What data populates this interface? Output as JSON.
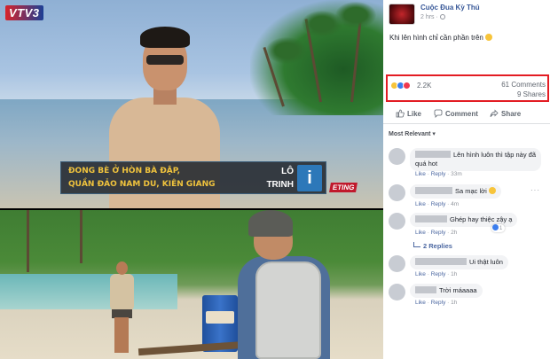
{
  "video": {
    "channel_logo": "VTV3",
    "caption_line1": "ĐONG BÈ Ở HÒN BÀ ĐẬP,",
    "caption_line2": "QUẦN ĐẢO NAM DU, KIÊN GIANG",
    "name_line1": "LÔ",
    "name_line2": "TRINH",
    "badge": "i",
    "corner_logo": "ETING"
  },
  "post": {
    "page_name": "Cuộc Đua Kỳ Thú",
    "time": "2 hrs",
    "text": "Khi lên hình chỉ cần phần trên",
    "reaction_count": "2.2K",
    "comments_count": "61 Comments",
    "shares_count": "9 Shares",
    "accent_color": "#e31c23"
  },
  "actions": {
    "like": "Like",
    "comment": "Comment",
    "share": "Share"
  },
  "sort": {
    "label": "Most Relevant",
    "arrow": "▾"
  },
  "comments": [
    {
      "text": "Lên hình luôn thì tập này đã quá hot",
      "like": "Like",
      "reply": "Reply",
      "time": "33m"
    },
    {
      "text": "Sa mạc lời",
      "like": "Like",
      "reply": "Reply",
      "time": "4m"
    },
    {
      "text": "Ghép hay thiệc zậy ạ",
      "like": "Like",
      "reply": "Reply",
      "time": "2h",
      "reactions": "1"
    },
    {
      "text": "Ui thật luôn",
      "like": "Like",
      "reply": "Reply",
      "time": "1h"
    },
    {
      "text": "Trời máaaaa",
      "like": "Like",
      "reply": "Reply",
      "time": "1h"
    }
  ],
  "replies_link": "2 Replies",
  "dot_sep": "·"
}
